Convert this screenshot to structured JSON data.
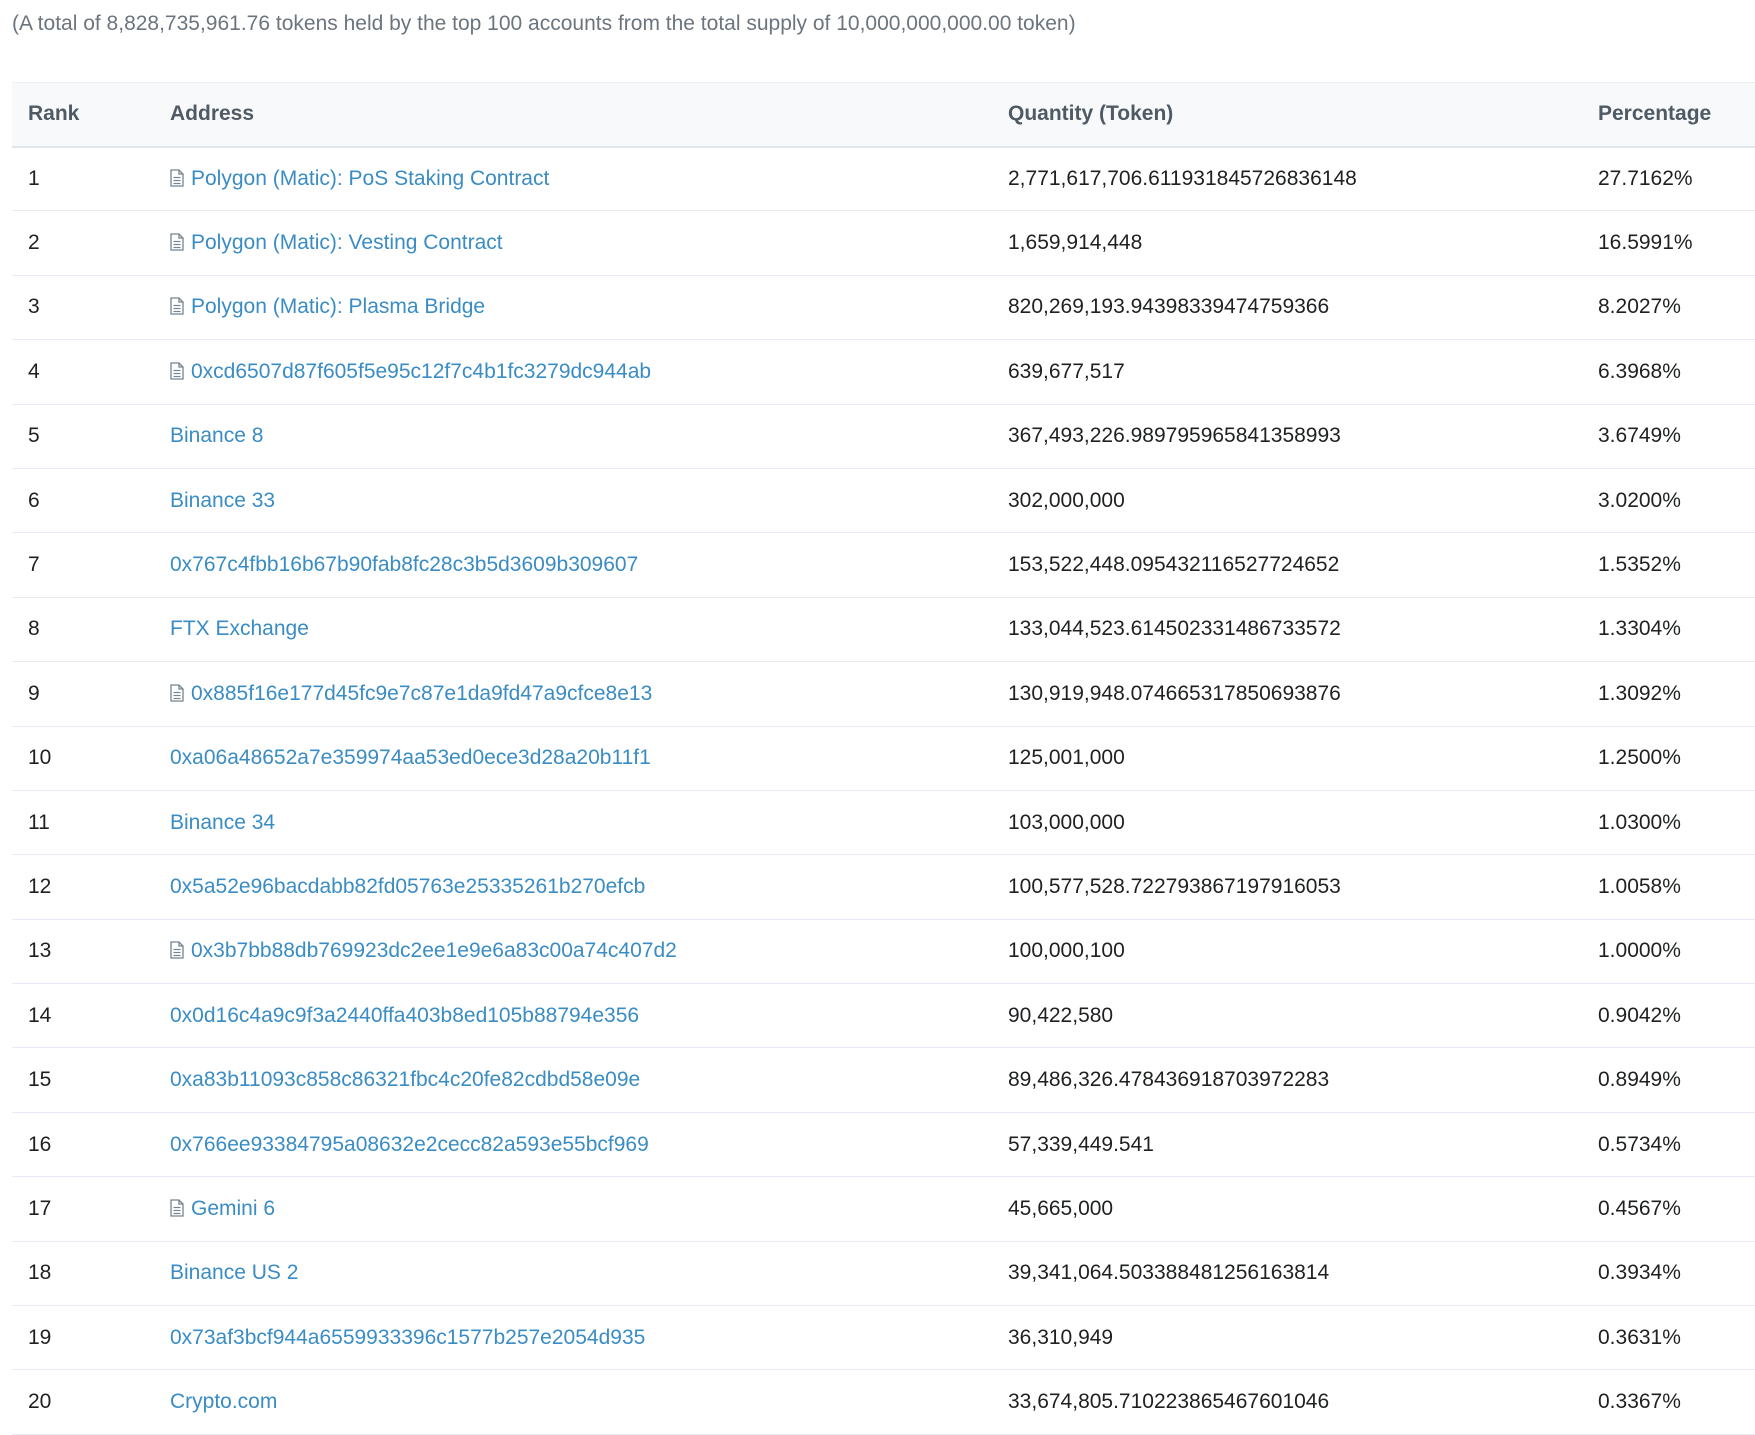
{
  "summary": "(A total of 8,828,735,961.76 tokens held by the top 100 accounts from the total supply of 10,000,000,000.00 token)",
  "table": {
    "headers": {
      "rank": "Rank",
      "address": "Address",
      "quantity": "Quantity (Token)",
      "percentage": "Percentage"
    },
    "rows": [
      {
        "rank": "1",
        "address": "Polygon (Matic): PoS Staking Contract",
        "contract": true,
        "quantity": "2,771,617,706.611931845726836148",
        "percentage": "27.7162%"
      },
      {
        "rank": "2",
        "address": "Polygon (Matic): Vesting Contract",
        "contract": true,
        "quantity": "1,659,914,448",
        "percentage": "16.5991%"
      },
      {
        "rank": "3",
        "address": "Polygon (Matic): Plasma Bridge",
        "contract": true,
        "quantity": "820,269,193.94398339474759366",
        "percentage": "8.2027%"
      },
      {
        "rank": "4",
        "address": "0xcd6507d87f605f5e95c12f7c4b1fc3279dc944ab",
        "contract": true,
        "quantity": "639,677,517",
        "percentage": "6.3968%"
      },
      {
        "rank": "5",
        "address": "Binance 8",
        "contract": false,
        "quantity": "367,493,226.989795965841358993",
        "percentage": "3.6749%"
      },
      {
        "rank": "6",
        "address": "Binance 33",
        "contract": false,
        "quantity": "302,000,000",
        "percentage": "3.0200%"
      },
      {
        "rank": "7",
        "address": "0x767c4fbb16b67b90fab8fc28c3b5d3609b309607",
        "contract": false,
        "quantity": "153,522,448.095432116527724652",
        "percentage": "1.5352%"
      },
      {
        "rank": "8",
        "address": "FTX Exchange",
        "contract": false,
        "quantity": "133,044,523.614502331486733572",
        "percentage": "1.3304%"
      },
      {
        "rank": "9",
        "address": "0x885f16e177d45fc9e7c87e1da9fd47a9cfce8e13",
        "contract": true,
        "quantity": "130,919,948.074665317850693876",
        "percentage": "1.3092%"
      },
      {
        "rank": "10",
        "address": "0xa06a48652a7e359974aa53ed0ece3d28a20b11f1",
        "contract": false,
        "quantity": "125,001,000",
        "percentage": "1.2500%"
      },
      {
        "rank": "11",
        "address": "Binance 34",
        "contract": false,
        "quantity": "103,000,000",
        "percentage": "1.0300%"
      },
      {
        "rank": "12",
        "address": "0x5a52e96bacdabb82fd05763e25335261b270efcb",
        "contract": false,
        "quantity": "100,577,528.722793867197916053",
        "percentage": "1.0058%"
      },
      {
        "rank": "13",
        "address": "0x3b7bb88db769923dc2ee1e9e6a83c00a74c407d2",
        "contract": true,
        "quantity": "100,000,100",
        "percentage": "1.0000%"
      },
      {
        "rank": "14",
        "address": "0x0d16c4a9c9f3a2440ffa403b8ed105b88794e356",
        "contract": false,
        "quantity": "90,422,580",
        "percentage": "0.9042%"
      },
      {
        "rank": "15",
        "address": "0xa83b11093c858c86321fbc4c20fe82cdbd58e09e",
        "contract": false,
        "quantity": "89,486,326.478436918703972283",
        "percentage": "0.8949%"
      },
      {
        "rank": "16",
        "address": "0x766ee93384795a08632e2cecc82a593e55bcf969",
        "contract": false,
        "quantity": "57,339,449.541",
        "percentage": "0.5734%"
      },
      {
        "rank": "17",
        "address": "Gemini 6",
        "contract": true,
        "quantity": "45,665,000",
        "percentage": "0.4567%"
      },
      {
        "rank": "18",
        "address": "Binance US 2",
        "contract": false,
        "quantity": "39,341,064.503388481256163814",
        "percentage": "0.3934%"
      },
      {
        "rank": "19",
        "address": "0x73af3bcf944a6559933396c1577b257e2054d935",
        "contract": false,
        "quantity": "36,310,949",
        "percentage": "0.3631%"
      },
      {
        "rank": "20",
        "address": "Crypto.com",
        "contract": false,
        "quantity": "33,674,805.710223865467601046",
        "percentage": "0.3367%"
      }
    ]
  },
  "colors": {
    "link": "#3a8cc4",
    "header_bg": "#f8f9fa",
    "row_border": "#e7eaf3",
    "muted_text": "#6c757d"
  },
  "icons": {
    "contract": "file-document-icon"
  }
}
